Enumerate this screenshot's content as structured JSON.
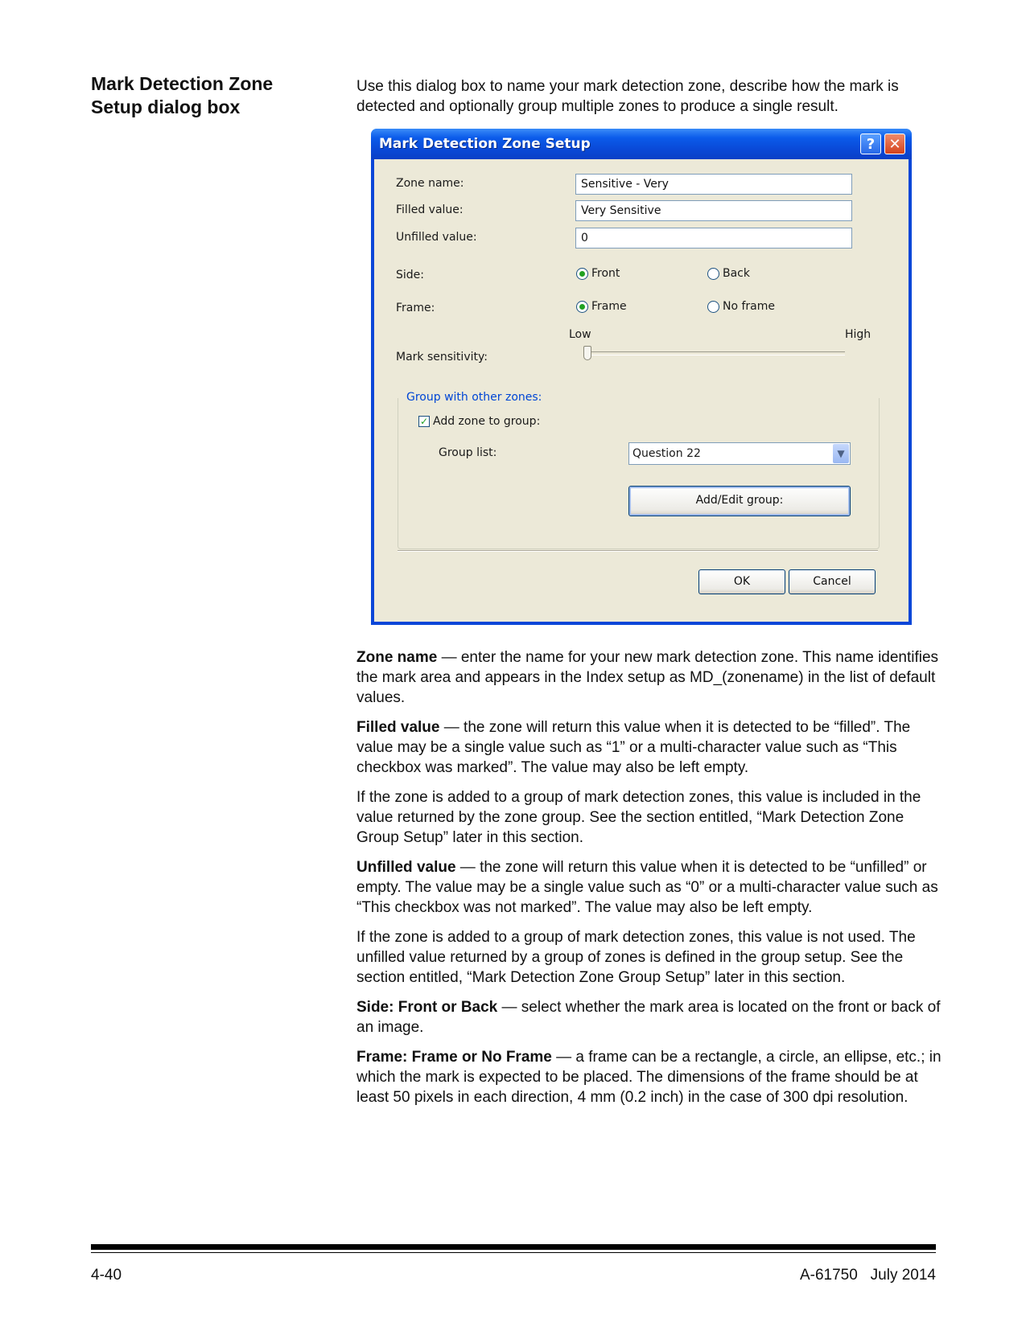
{
  "heading": "Mark Detection Zone Setup dialog box",
  "intro": "Use this dialog box to name your mark detection zone, describe how the mark is detected and optionally group multiple zones to produce a single result.",
  "dialog": {
    "title": "Mark Detection Zone Setup",
    "help_glyph": "?",
    "close_glyph": "✕",
    "zone_name_label": "Zone name:",
    "zone_name_value": "Sensitive - Very",
    "filled_value_label": "Filled value:",
    "filled_value_value": "Very Sensitive",
    "unfilled_value_label": "Unfilled value:",
    "unfilled_value_value": "0",
    "side_label": "Side:",
    "side_front": "Front",
    "side_back": "Back",
    "side_selected": "Front",
    "frame_label": "Frame:",
    "frame_frame": "Frame",
    "frame_no_frame": "No frame",
    "frame_selected": "Frame",
    "slider_low": "Low",
    "slider_high": "High",
    "sensitivity_label": "Mark sensitivity:",
    "sensitivity_level": 0,
    "group_legend": "Group with other zones:",
    "add_to_group_label": "Add zone to group:",
    "add_to_group_checked": true,
    "group_list_label": "Group list:",
    "group_list_value": "Question 22",
    "add_edit_group_button": "Add/Edit group:",
    "ok_button": "OK",
    "cancel_button": "Cancel"
  },
  "body": [
    {
      "term": "Zone name",
      "text": " — enter the name for your new mark detection zone. This name identifies the mark area and appears in the Index setup as MD_(zonename) in the list of default values."
    },
    {
      "term": "Filled value",
      "text": " — the zone will return this value when it is detected to be “filled”. The value may be a single value such as “1” or a multi-character value such as “This checkbox was marked”. The value may also be left empty."
    },
    {
      "term": "",
      "text": "If the zone is added to a group of mark detection zones, this value is included in the value returned by the zone group. See the section entitled, “Mark Detection Zone Group Setup” later in this section."
    },
    {
      "term": "Unfilled value",
      "text": " — the zone will return this value when it is detected to be “unfilled” or empty. The value may be a single value such as “0” or a multi-character value such as “This checkbox was not marked”. The value may also be left empty."
    },
    {
      "term": "",
      "text": "If the zone is added to a group of mark detection zones, this value is not used. The unfilled value returned by a group of zones is defined in the group setup. See the section entitled, “Mark Detection Zone Group Setup” later in this section."
    },
    {
      "term": "Side: Front or Back",
      "text": " — select whether the mark area is located on the front or back of an image."
    },
    {
      "term": "Frame: Frame or No Frame",
      "text": " — a frame can be a rectangle, a circle, an ellipse, etc.; in which the mark is expected to be placed. The dimensions of the frame should be at least 50 pixels in each direction, 4 mm (0.2 inch) in the case of 300 dpi resolution."
    }
  ],
  "footer": {
    "page_number": "4-40",
    "doc_ref": "A-61750   July 2014"
  }
}
